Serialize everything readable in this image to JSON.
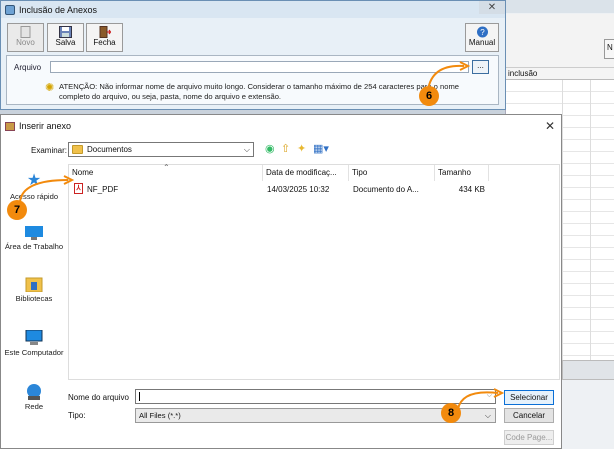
{
  "colors": {
    "accent_orange": "#f28a0d",
    "window_blue": "#6a8fb4",
    "selected_border": "#0a6fd6"
  },
  "background_app": {
    "visible_column_header": "inclusão"
  },
  "anexos_window": {
    "title": "Inclusão de Anexos",
    "close_glyph": "✕",
    "toolbar": {
      "novo_label": "Novo",
      "salva_label": "Salva",
      "fecha_label": "Fecha",
      "manual_label": "Manual"
    },
    "arquivo_label": "Arquivo",
    "browse_glyph": "...",
    "warning_text": "ATENÇÃO: Não informar nome de arquivo muito longo. Considerar o tamanho máximo de 254 caracteres para o nome completo do arquivo, ou seja, pasta, nome do arquivo e extensão."
  },
  "dialog": {
    "title": "Inserir anexo",
    "close_glyph": "✕",
    "examinar_label": "Examinar:",
    "examinar_value": "Documentos",
    "places": [
      {
        "label": "Acesso rápido",
        "icon": "star-icon"
      },
      {
        "label": "Área de Trabalho",
        "icon": "desktop-icon"
      },
      {
        "label": "Bibliotecas",
        "icon": "libraries-icon"
      },
      {
        "label": "Este Computador",
        "icon": "computer-icon"
      },
      {
        "label": "Rede",
        "icon": "network-icon"
      }
    ],
    "columns": {
      "nome": "Nome",
      "data": "Data de modificaç...",
      "tipo": "Tipo",
      "tamanho": "Tamanho"
    },
    "files": [
      {
        "name": "NF_PDF",
        "date": "14/03/2025 10:32",
        "type": "Documento do A...",
        "size": "434 KB"
      }
    ],
    "nome_label": "Nome do arquivo",
    "nome_value": "",
    "tipo_label": "Tipo:",
    "tipo_value": "All Files (*.*)",
    "selecionar_label": "Selecionar",
    "cancelar_label": "Cancelar",
    "codepage_label": "Code Page..."
  },
  "annotations": {
    "step_6": "6",
    "step_7": "7",
    "step_8": "8"
  }
}
